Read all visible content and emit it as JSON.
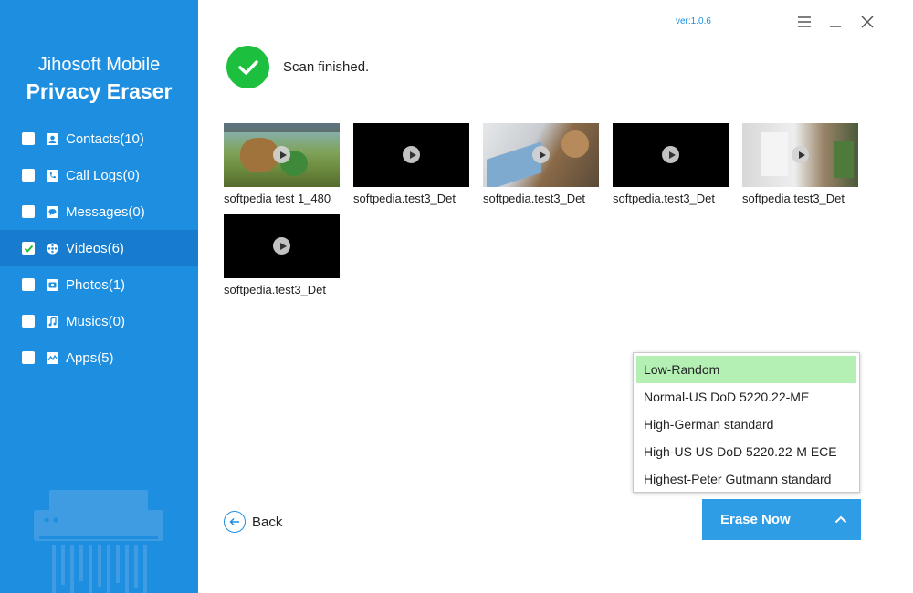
{
  "app": {
    "title_line1": "Jihosoft Mobile",
    "title_line2": "Privacy Eraser",
    "version": "ver:1.0.6"
  },
  "sidebar": {
    "items": [
      {
        "label": "Contacts(10)",
        "checked": false,
        "icon": "contacts-icon"
      },
      {
        "label": "Call Logs(0)",
        "checked": false,
        "icon": "call-logs-icon"
      },
      {
        "label": "Messages(0)",
        "checked": false,
        "icon": "messages-icon"
      },
      {
        "label": "Videos(6)",
        "checked": true,
        "icon": "videos-icon"
      },
      {
        "label": "Photos(1)",
        "checked": false,
        "icon": "photos-icon"
      },
      {
        "label": "Musics(0)",
        "checked": false,
        "icon": "musics-icon"
      },
      {
        "label": "Apps(5)",
        "checked": false,
        "icon": "apps-icon"
      }
    ]
  },
  "status": {
    "text": "Scan finished."
  },
  "videos": [
    {
      "label": "softpedia test 1_480"
    },
    {
      "label": "softpedia.test3_Det"
    },
    {
      "label": "softpedia.test3_Det"
    },
    {
      "label": "softpedia.test3_Det"
    },
    {
      "label": "softpedia.test3_Det"
    },
    {
      "label": "softpedia.test3_Det"
    }
  ],
  "erase_modes": {
    "options": [
      "Low-Random",
      "Normal-US DoD 5220.22-ME",
      "High-German standard",
      "High-US US DoD 5220.22-M ECE",
      "Highest-Peter Gutmann standard"
    ],
    "selected": "Low-Random"
  },
  "actions": {
    "back_label": "Back",
    "erase_label": "Erase Now"
  },
  "colors": {
    "sidebar": "#1e8fe0",
    "accent": "#2f9ce6",
    "success": "#1dbf3e",
    "selected_option": "#b4f0b4"
  }
}
